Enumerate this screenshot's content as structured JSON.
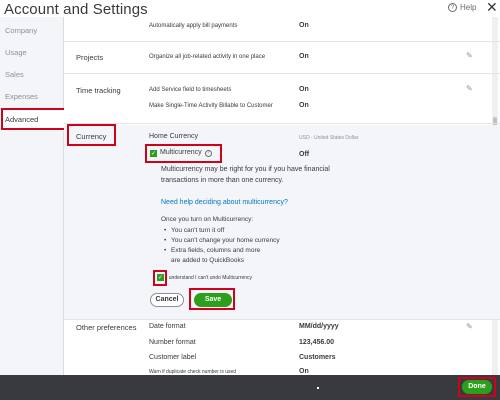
{
  "header": {
    "title": "Account and Settings",
    "help_label": "Help",
    "close_glyph": "✕"
  },
  "sidebar": {
    "items": [
      {
        "label": "Company"
      },
      {
        "label": "Usage"
      },
      {
        "label": "Sales"
      },
      {
        "label": "Expenses"
      },
      {
        "label": "Advanced"
      }
    ]
  },
  "rows": {
    "bill_payments": {
      "text": "Automatically apply bill payments",
      "value": "On"
    },
    "projects": {
      "label": "Projects",
      "text": "Organize all job-related activity in one place",
      "value": "On"
    },
    "time_tracking": {
      "label": "Time tracking",
      "items": [
        {
          "text": "Add Service field to timesheets",
          "value": "On"
        },
        {
          "text": "Make Single-Time Activity Billable to Customer",
          "value": "On"
        }
      ]
    },
    "currency": {
      "label": "Currency",
      "home_currency_label": "Home Currency",
      "home_currency_value": "USD - United States Dollar",
      "multicurrency_label": "Multicurrency",
      "multicurrency_value": "Off",
      "description": "Multicurrency may be right for you if you have financial transactions in more than one currency.",
      "help_link": "Need help deciding about multicurrency?",
      "once_text": "Once you turn on Multicurrency:",
      "bullets": [
        "You can't turn it off",
        "You can't change your home currency",
        "Extra fields, columns and more are added to QuickBooks"
      ],
      "understand_label": "I understand I can't undo Multicurrency",
      "cancel_label": "Cancel",
      "save_label": "Save"
    },
    "other_preferences": {
      "label": "Other preferences",
      "items": [
        {
          "text": "Date format",
          "value": "MM/dd/yyyy"
        },
        {
          "text": "Number format",
          "value": "123,456.00"
        },
        {
          "text": "Customer label",
          "value": "Customers"
        },
        {
          "text": "Warn if duplicate check number is used",
          "value": "On"
        }
      ]
    }
  },
  "footer": {
    "done_label": "Done"
  },
  "colors": {
    "accent_green": "#2ca01c",
    "highlight_red": "#d0021b",
    "link_blue": "#0077c5",
    "footer_bg": "#393a3d"
  }
}
